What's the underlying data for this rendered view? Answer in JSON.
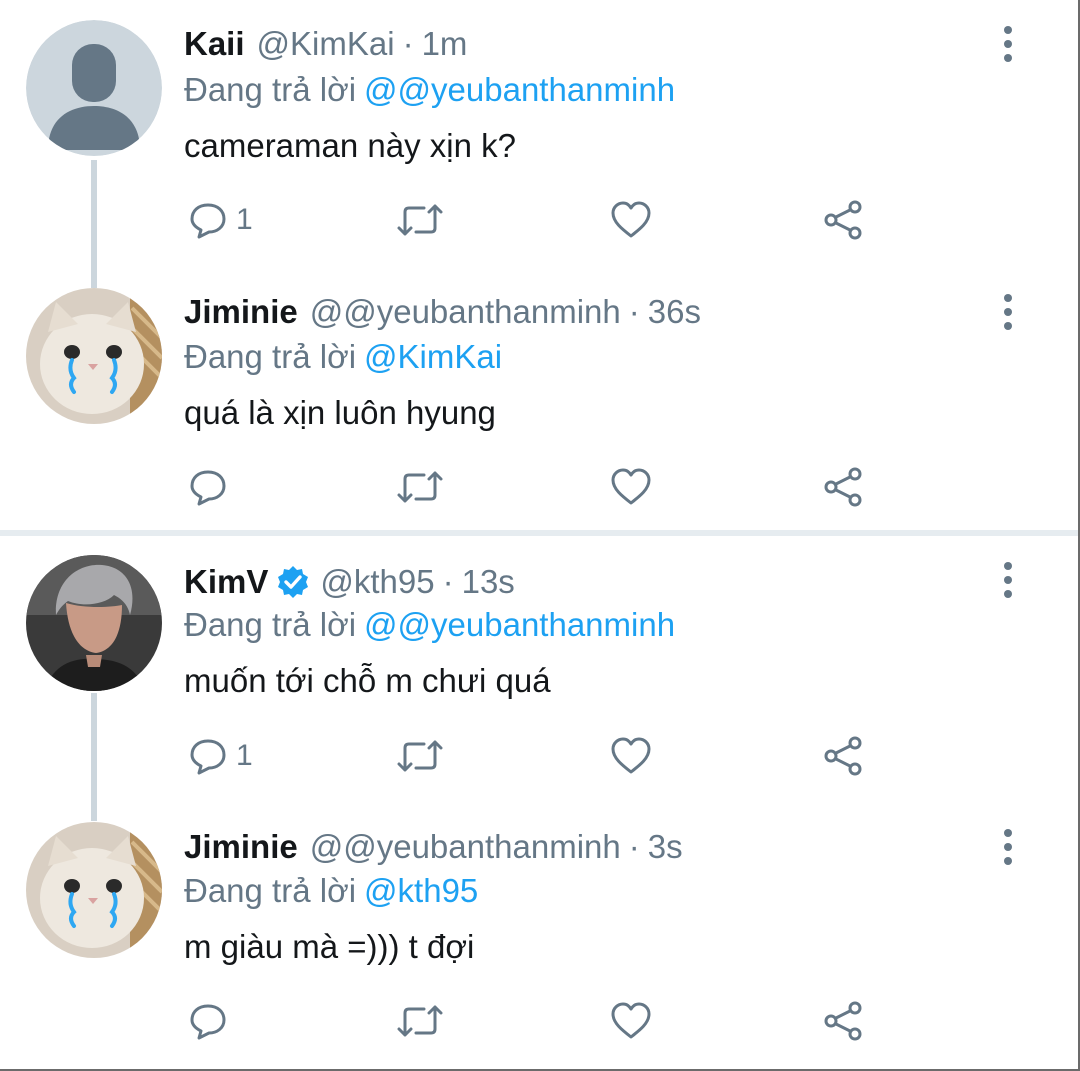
{
  "colors": {
    "accent": "#1da1f2",
    "muted": "#657786",
    "text": "#14171a",
    "verified": "#1da1f2"
  },
  "threads": [
    {
      "tweets": [
        {
          "name": "Kaii",
          "handle": "@KimKai",
          "dot": "·",
          "time": "1m",
          "replying_label": "Đang trả lời",
          "replying_to": "@@yeubanthanminh",
          "text": "cameraman này xịn k?",
          "reply_count": "1",
          "avatar": "default-profile-avatar"
        },
        {
          "name": "Jiminie",
          "handle": "@@yeubanthanminh",
          "dot": "·",
          "time": "36s",
          "replying_label": "Đang trả lời",
          "replying_to": "@KimKai",
          "text": "quá là xịn luôn hyung",
          "reply_count": "",
          "avatar": "crying-cat-avatar"
        }
      ]
    },
    {
      "tweets": [
        {
          "name": "KimV",
          "verified": true,
          "handle": "@kth95",
          "dot": "·",
          "time": "13s",
          "replying_label": "Đang trả lời",
          "replying_to": "@@yeubanthanminh",
          "text": "muốn tới chỗ m chưi quá",
          "reply_count": "1",
          "avatar": "person-photo-avatar"
        },
        {
          "name": "Jiminie",
          "handle": "@@yeubanthanminh",
          "dot": "·",
          "time": "3s",
          "replying_label": "Đang trả lời",
          "replying_to": "@kth95",
          "text": "m giàu mà =))) t đợi",
          "reply_count": "",
          "avatar": "crying-cat-avatar"
        }
      ]
    }
  ],
  "icons": {
    "reply": "reply-icon",
    "retweet": "retweet-icon",
    "like": "heart-icon",
    "share": "share-icon",
    "more": "more-vertical-icon",
    "verified": "verified-badge-icon"
  }
}
